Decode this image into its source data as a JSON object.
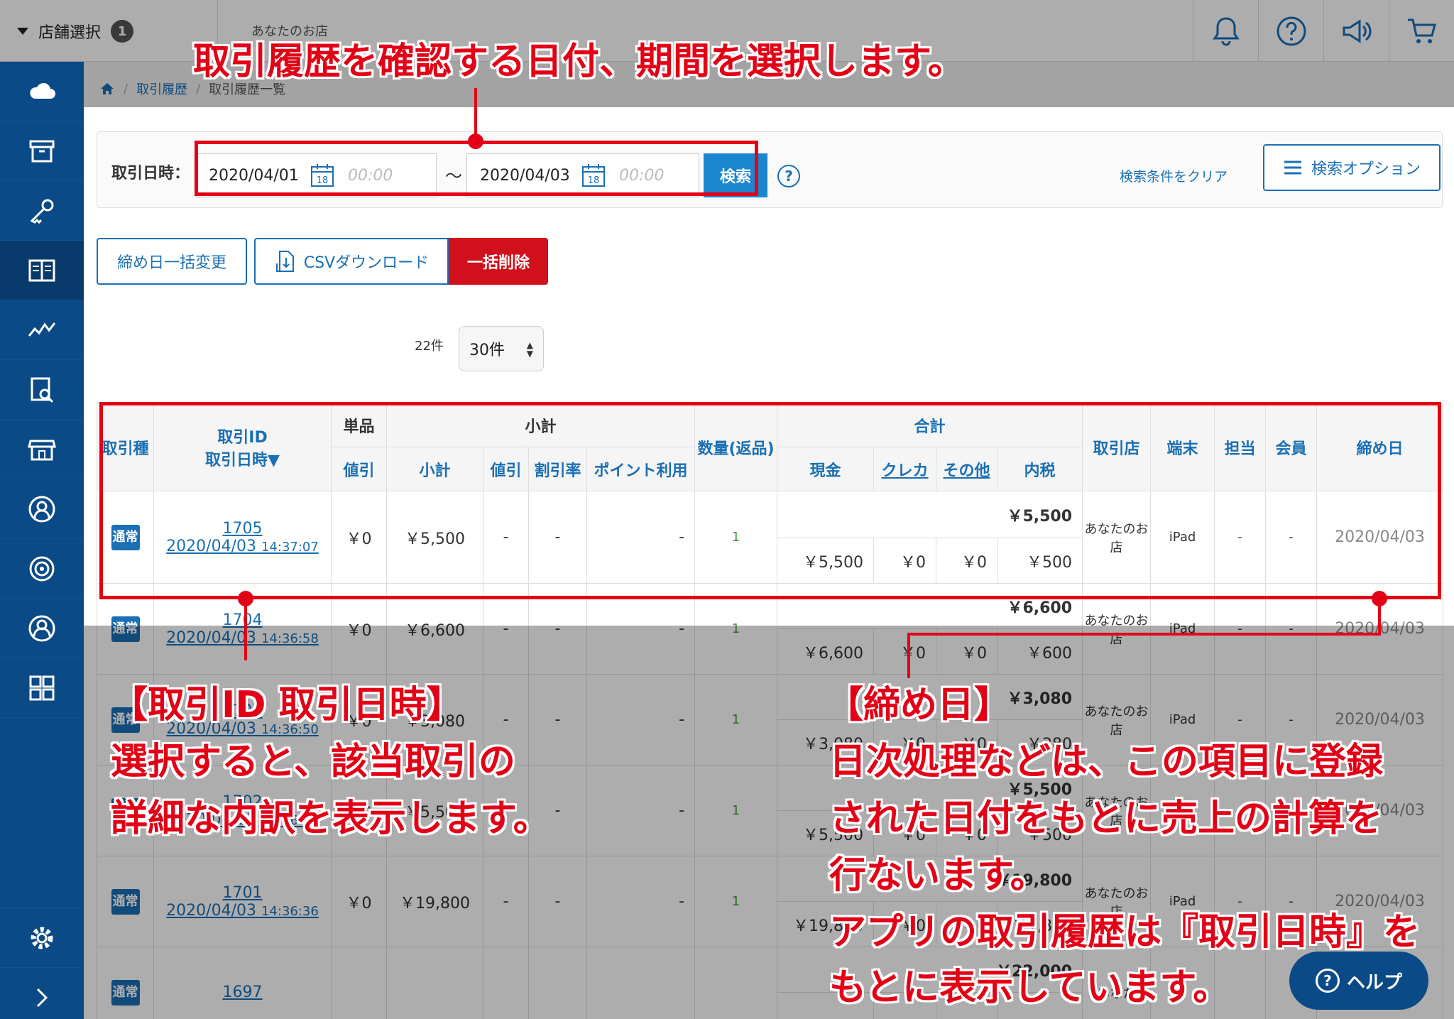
{
  "topbar": {
    "store_select_label": "店舗選択",
    "store_count": "1",
    "store_name": "あなたのお店"
  },
  "breadcrumb": {
    "current_parent": "取引履歴",
    "current": "取引履歴一覧"
  },
  "search": {
    "label": "取引日時：",
    "from_date": "2020/04/01",
    "from_time_placeholder": "00:00",
    "to_date": "2020/04/03",
    "to_time_placeholder": "00:00",
    "calendar_day": "18",
    "tilde": "〜",
    "search_button": "検索",
    "help": "?",
    "clear_link": "検索条件をクリア",
    "options_button": "検索オプション"
  },
  "actions": {
    "bulk_close_date": "締め日一括変更",
    "csv_download": "CSVダウンロード",
    "bulk_delete": "一括削除"
  },
  "paging": {
    "count": "22件",
    "per_page": "30件"
  },
  "table": {
    "headers": {
      "type": "取引種",
      "id_line1": "取引ID",
      "id_line2": "取引日時▼",
      "unit": "単品",
      "subtotal_group": "小計",
      "qty": "数量(返品)",
      "total_group": "合計",
      "store": "取引店",
      "terminal": "端末",
      "staff": "担当",
      "member": "会員",
      "close_date": "締め日",
      "discount": "値引",
      "subtotal": "小計",
      "sub_discount": "値引",
      "discount_rate": "割引率",
      "point_use": "ポイント利用",
      "cash": "現金",
      "credit": "クレカ",
      "other": "その他",
      "tax": "内税"
    },
    "rows": [
      {
        "type": "通常",
        "id": "1705",
        "date": "2020/04/03",
        "time": "14:37:07",
        "unit_discount": "￥0",
        "subtotal": "￥5,500",
        "sub_discount": "-",
        "rate": "-",
        "point": "-",
        "qty": "1",
        "total": "￥5,500",
        "cash": "￥5,500",
        "credit": "￥0",
        "other": "￥0",
        "tax": "￥500",
        "store": "あなたのお店",
        "terminal": "iPad",
        "staff": "-",
        "member": "-",
        "close_date": "2020/04/03"
      },
      {
        "type": "通常",
        "id": "1704",
        "date": "2020/04/03",
        "time": "14:36:58",
        "unit_discount": "￥0",
        "subtotal": "￥6,600",
        "sub_discount": "-",
        "rate": "-",
        "point": "-",
        "qty": "1",
        "total": "￥6,600",
        "cash": "￥6,600",
        "credit": "￥0",
        "other": "￥0",
        "tax": "￥600",
        "store": "あなたのお店",
        "terminal": "iPad",
        "staff": "-",
        "member": "-",
        "close_date": "2020/04/03"
      },
      {
        "type": "通常",
        "id": "1703",
        "date": "2020/04/03",
        "time": "14:36:50",
        "unit_discount": "￥0",
        "subtotal": "￥3,080",
        "sub_discount": "-",
        "rate": "-",
        "point": "-",
        "qty": "1",
        "total": "￥3,080",
        "cash": "￥3,080",
        "credit": "￥0",
        "other": "￥0",
        "tax": "￥280",
        "store": "あなたのお店",
        "terminal": "iPad",
        "staff": "-",
        "member": "-",
        "close_date": "2020/04/03"
      },
      {
        "type": "通常",
        "id": "1702",
        "date": "2020/04/03",
        "time": "14:36:43",
        "unit_discount": "￥0",
        "subtotal": "￥5,500",
        "sub_discount": "-",
        "rate": "-",
        "point": "-",
        "qty": "1",
        "total": "￥5,500",
        "cash": "￥5,500",
        "credit": "￥0",
        "other": "￥0",
        "tax": "￥500",
        "store": "あなたのお店",
        "terminal": "iPad",
        "staff": "-",
        "member": "-",
        "close_date": "2020/04/03"
      },
      {
        "type": "通常",
        "id": "1701",
        "date": "2020/04/03",
        "time": "14:36:36",
        "unit_discount": "￥0",
        "subtotal": "￥19,800",
        "sub_discount": "-",
        "rate": "-",
        "point": "-",
        "qty": "1",
        "total": "￥19,800",
        "cash": "￥19,800",
        "credit": "￥0",
        "other": "￥0",
        "tax": "￥1,800",
        "store": "あなたのお店",
        "terminal": "iPad",
        "staff": "-",
        "member": "-",
        "close_date": "2020/04/03"
      },
      {
        "type": "通常",
        "id": "1697",
        "date": "",
        "time": "",
        "unit_discount": "",
        "subtotal": "",
        "sub_discount": "",
        "rate": "",
        "point": "",
        "qty": "",
        "total": "￥22,000",
        "cash": "",
        "credit": "",
        "other": "",
        "tax": "",
        "store": "あなた",
        "terminal": "",
        "staff": "",
        "member": "",
        "close_date": ""
      }
    ]
  },
  "annotations": {
    "top": "取引履歴を確認する日付、期間を選択します。",
    "left_title": "【取引ID 取引日時】",
    "left_line1": "選択すると、該当取引の",
    "left_line2": "詳細な内訳を表示します。",
    "right_title": "【締め日】",
    "right_line1": "日次処理などは、この項目に登録",
    "right_line2": "された日付をもとに売上の計算を",
    "right_line3": "行ないます。",
    "right_line4": "アプリの取引履歴は『取引日時』を",
    "right_line5": "もとに表示しています。"
  },
  "help_fab": {
    "label": "ヘルプ",
    "q": "?"
  },
  "colors": {
    "sidebar": "#0a4a86",
    "accent": "#1a6fb5",
    "danger": "#d0101b",
    "annotation": "#e30016"
  }
}
